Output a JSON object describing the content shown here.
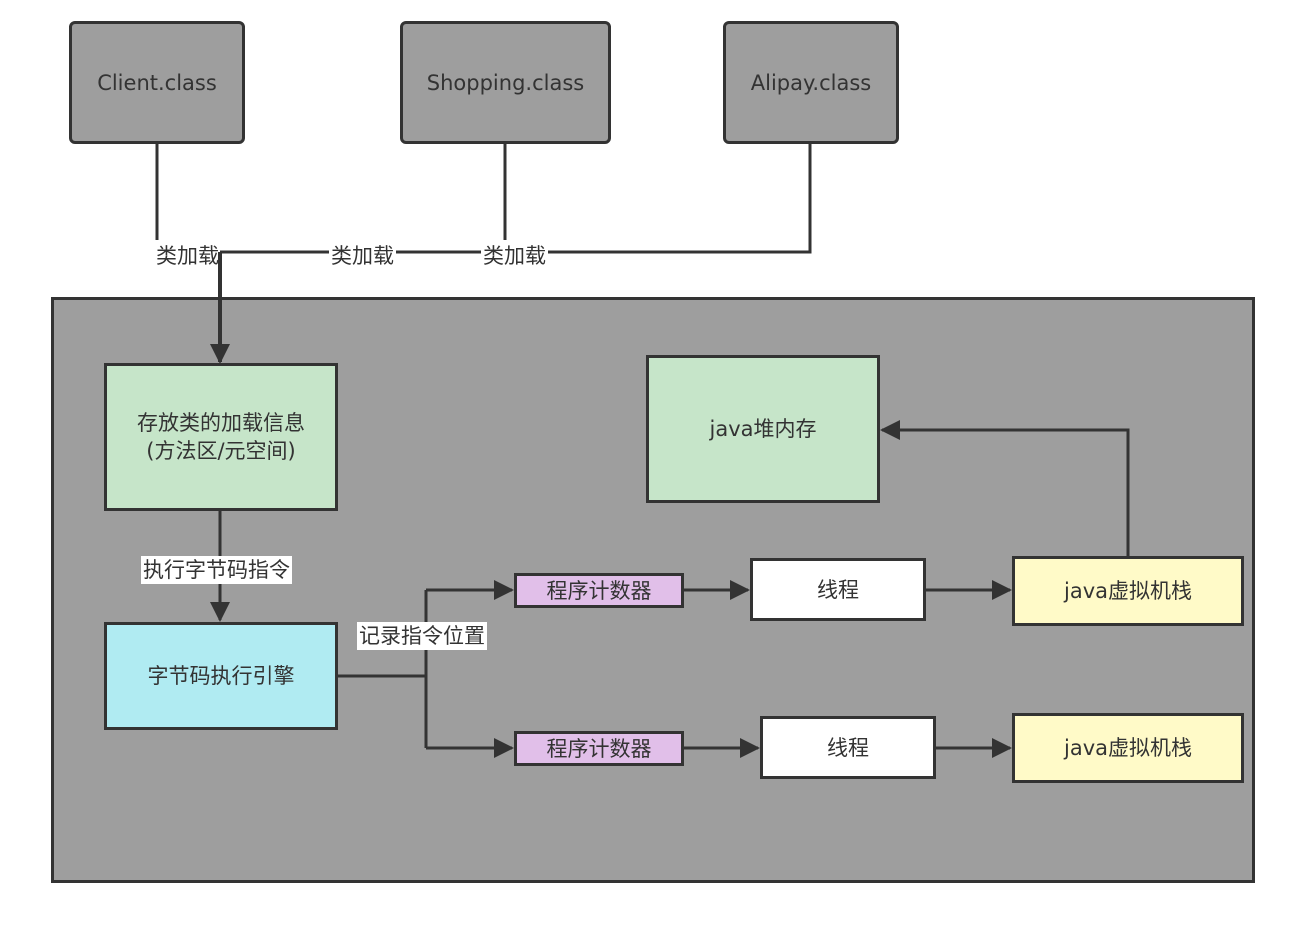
{
  "classes": {
    "client": "Client.class",
    "shopping": "Shopping.class",
    "alipay": "Alipay.class"
  },
  "edge_labels": {
    "load1": "类加载",
    "load2": "类加载",
    "load3": "类加载",
    "execute": "执行字节码指令",
    "record": "记录指令位置"
  },
  "nodes": {
    "method_area": "存放类的加载信息\n(方法区/元空间)",
    "heap": "java堆内存",
    "engine": "字节码执行引擎",
    "pc1": "程序计数器",
    "pc2": "程序计数器",
    "thread1": "线程",
    "thread2": "线程",
    "stack1": "java虚拟机栈",
    "stack2": "java虚拟机栈"
  },
  "colors": {
    "class_fill": "#9e9e9e",
    "container_fill": "#9e9e9e",
    "green": "#c6e5c9",
    "cyan": "#b0ebf2",
    "purple": "#e1bfe9",
    "yellow": "#fffac8",
    "line": "#333333"
  }
}
